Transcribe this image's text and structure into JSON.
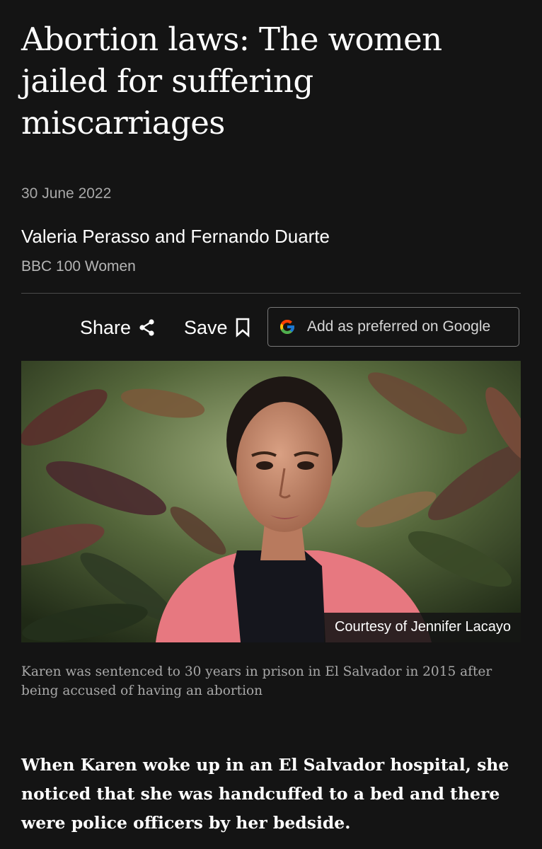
{
  "article": {
    "headline": "Abortion laws: The women jailed for suffering miscarriages",
    "date": "30 June 2022",
    "author": "Valeria Perasso and Fernando Duarte",
    "author_role": "BBC 100 Women"
  },
  "actions": {
    "share_label": "Share",
    "share_icon": "share-icon",
    "save_label": "Save",
    "save_icon": "bookmark-icon",
    "google_label": "Add as preferred on Google",
    "google_icon": "google-g-icon"
  },
  "image": {
    "credit": "Courtesy of Jennifer Lacayo",
    "caption": "Karen was sentenced to 30 years in prison in El Salvador in 2015 after being accused of having an abortion"
  },
  "body": {
    "lead_paragraph": "When Karen woke up in an El Salvador hospital, she noticed that she was handcuffed to a bed and there were police officers by her bedside."
  },
  "colors": {
    "background": "#141414",
    "text": "#ffffff",
    "muted_text": "#a8a8a8",
    "divider": "#4a4a4a",
    "button_border": "#7a7a7a"
  }
}
